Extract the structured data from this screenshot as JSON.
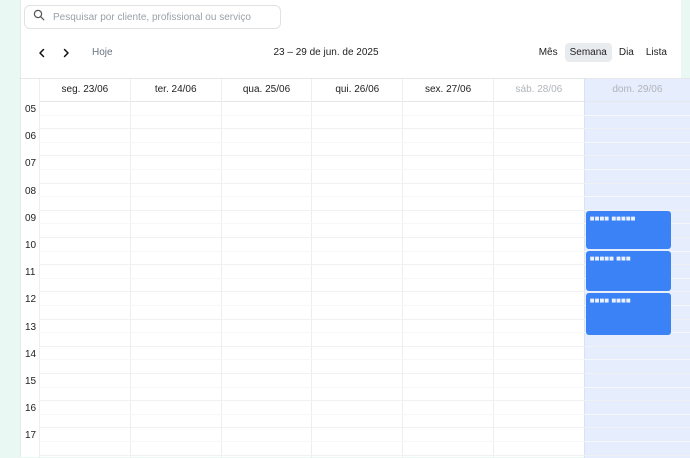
{
  "search": {
    "placeholder": "Pesquisar por cliente, profissional ou serviço"
  },
  "toolbar": {
    "today_label": "Hoje",
    "date_range": "23 – 29 de jun. de 2025",
    "views": [
      "Mês",
      "Semana",
      "Dia",
      "Lista"
    ],
    "active_view": "Semana"
  },
  "week": {
    "days": [
      {
        "label": "seg. 23/06",
        "muted": false
      },
      {
        "label": "ter. 24/06",
        "muted": false
      },
      {
        "label": "qua. 25/06",
        "muted": false
      },
      {
        "label": "qui. 26/06",
        "muted": false
      },
      {
        "label": "sex. 27/06",
        "muted": false
      },
      {
        "label": "sáb. 28/06",
        "muted": true
      },
      {
        "label": "dom. 29/06",
        "muted": true
      }
    ],
    "hours": [
      "05",
      "06",
      "07",
      "08",
      "09",
      "10",
      "11",
      "12",
      "13",
      "14",
      "15",
      "16",
      "17"
    ]
  },
  "events": [
    {
      "day": 6,
      "title": "■■■■ ■■■■■"
    },
    {
      "day": 6,
      "title": "■■■■■ ■■■"
    },
    {
      "day": 6,
      "title": "■■■■ ■■■■"
    }
  ],
  "colors": {
    "accent": "#3b82f6",
    "weekend_bg": "#e6edfd",
    "page_bg": "#eaf8f4"
  }
}
